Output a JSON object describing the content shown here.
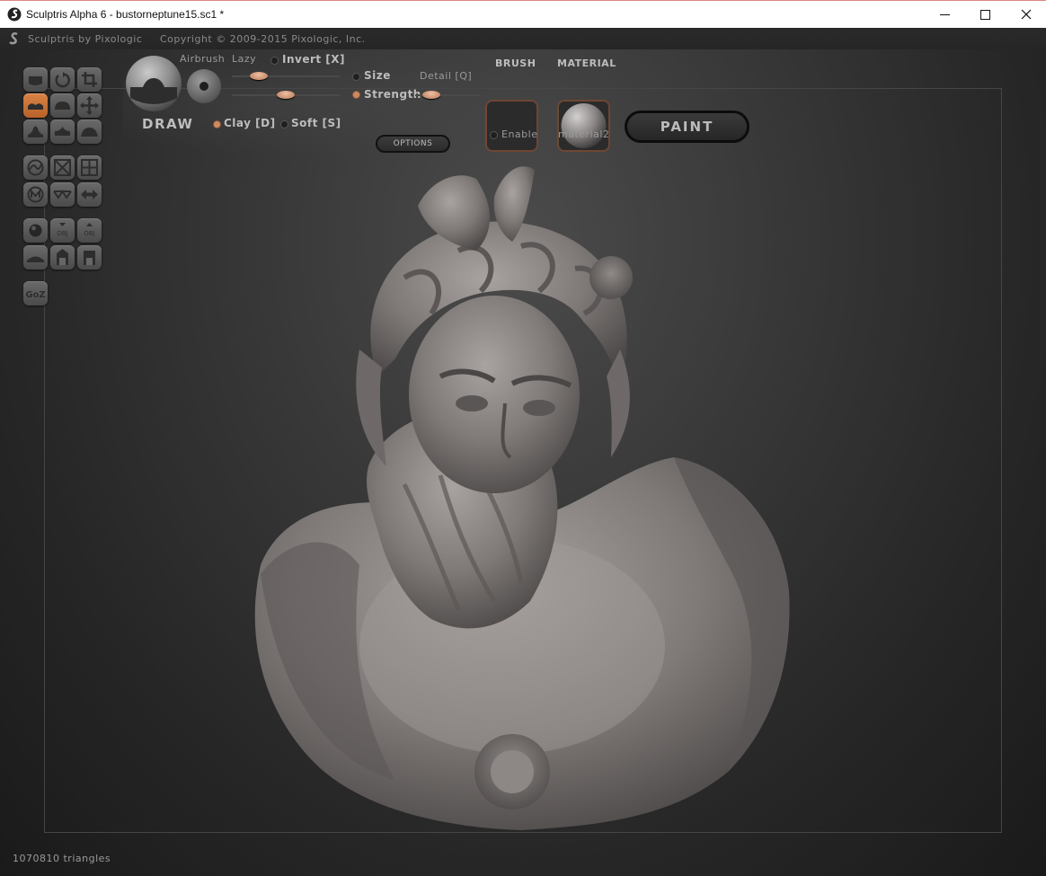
{
  "window": {
    "title": "Sculptris Alpha 6 - bustorneptune15.sc1 *",
    "minimize_glyph": "minimize-icon",
    "maximize_glyph": "maximize-icon",
    "close_glyph": "close-icon"
  },
  "app_header": {
    "credit": "Sculptris by Pixologic",
    "copyright": "Copyright © 2009-2015 Pixologic, Inc."
  },
  "brush_panel": {
    "tool_name": "DRAW",
    "airbrush_label": "Airbrush",
    "lazy_label": "Lazy",
    "invert_label": "Invert [X]",
    "invert_on": false,
    "size_label": "Size",
    "size_on": false,
    "strength_label": "Strength",
    "strength_on": true,
    "detail_label": "Detail [Q]",
    "clay_label": "Clay [D]",
    "clay_on": true,
    "soft_label": "Soft [S]",
    "soft_on": false,
    "options_label": "OPTIONS",
    "size_slider_value": 0.2,
    "strength_slider_value": 0.5,
    "detail_slider_value": 0.15
  },
  "brush": {
    "header": "BRUSH",
    "enable_label": "Enable",
    "enable_on": false
  },
  "material": {
    "header": "MATERIAL",
    "name": "material2"
  },
  "paint_button_label": "PAINT",
  "tools": [
    {
      "name": "draw-tool",
      "active": false
    },
    {
      "name": "rotate-tool",
      "active": false
    },
    {
      "name": "crop-tool",
      "active": false
    },
    {
      "name": "flatten-tool",
      "active": true
    },
    {
      "name": "inflate-tool",
      "active": false
    },
    {
      "name": "grab-tool",
      "active": false
    },
    {
      "name": "pinch-tool",
      "active": false
    },
    {
      "name": "crease-tool",
      "active": false
    },
    {
      "name": "smooth-tool",
      "active": false
    },
    {
      "name": "reduce-brush-tool",
      "active": false
    },
    {
      "name": "reduce-selected-tool",
      "active": false
    },
    {
      "name": "subdivide-tool",
      "active": false
    },
    {
      "name": "mask-tool",
      "active": false
    },
    {
      "name": "wireframe-tool",
      "active": false
    },
    {
      "name": "symmetry-tool",
      "active": false
    },
    {
      "name": "new-sphere-tool",
      "active": false
    },
    {
      "name": "import-obj-tool",
      "active": false
    },
    {
      "name": "export-obj-tool",
      "active": false
    },
    {
      "name": "new-plane-tool",
      "active": false
    },
    {
      "name": "open-file-tool",
      "active": false
    },
    {
      "name": "save-file-tool",
      "active": false
    },
    {
      "name": "goz-tool",
      "active": false
    }
  ],
  "icon_labels": {
    "obj": "OBJ",
    "goz": "GoZ"
  },
  "status": {
    "triangles": "1070810 triangles"
  }
}
